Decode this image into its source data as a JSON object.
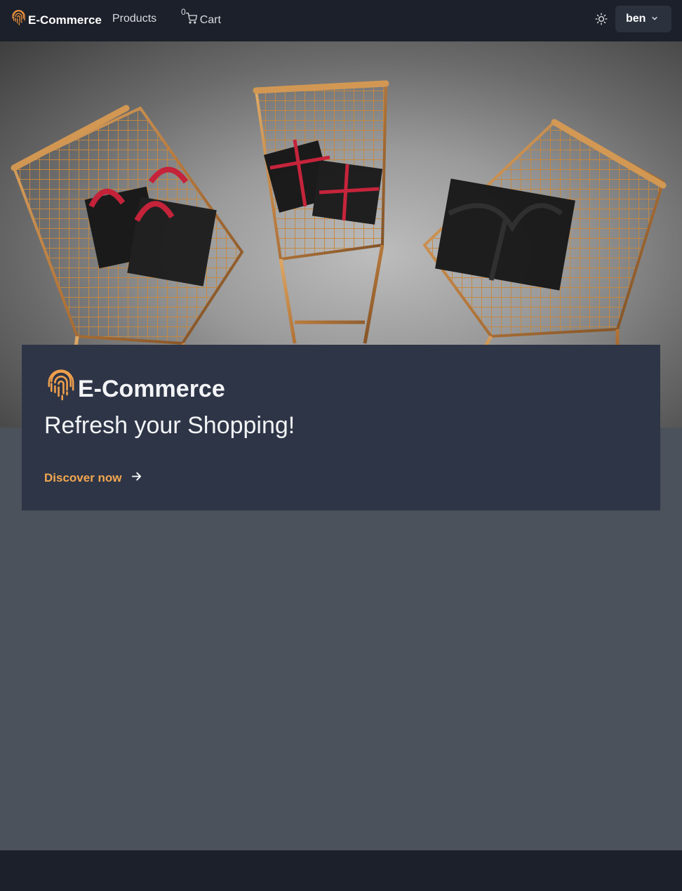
{
  "navbar": {
    "brand_name": "E-Commerce",
    "products_label": "Products",
    "cart_count": "0",
    "cart_label": "Cart",
    "user_name": "ben",
    "icons": {
      "brand": "fingerprint-icon",
      "cart": "shopping-cart-icon",
      "theme": "sun-icon",
      "user_menu": "chevron-down-icon"
    }
  },
  "hero": {
    "image": "shopping-carts-with-gifts-photo",
    "brand_name": "E-Commerce",
    "tagline": "Refresh your Shopping!",
    "cta_label": "Discover now",
    "cta_icon": "arrow-right-icon"
  },
  "colors": {
    "navbar_bg": "#1c202a",
    "page_bg": "#4b525b",
    "card_bg": "#2e3547",
    "accent": "#f2a74f"
  }
}
